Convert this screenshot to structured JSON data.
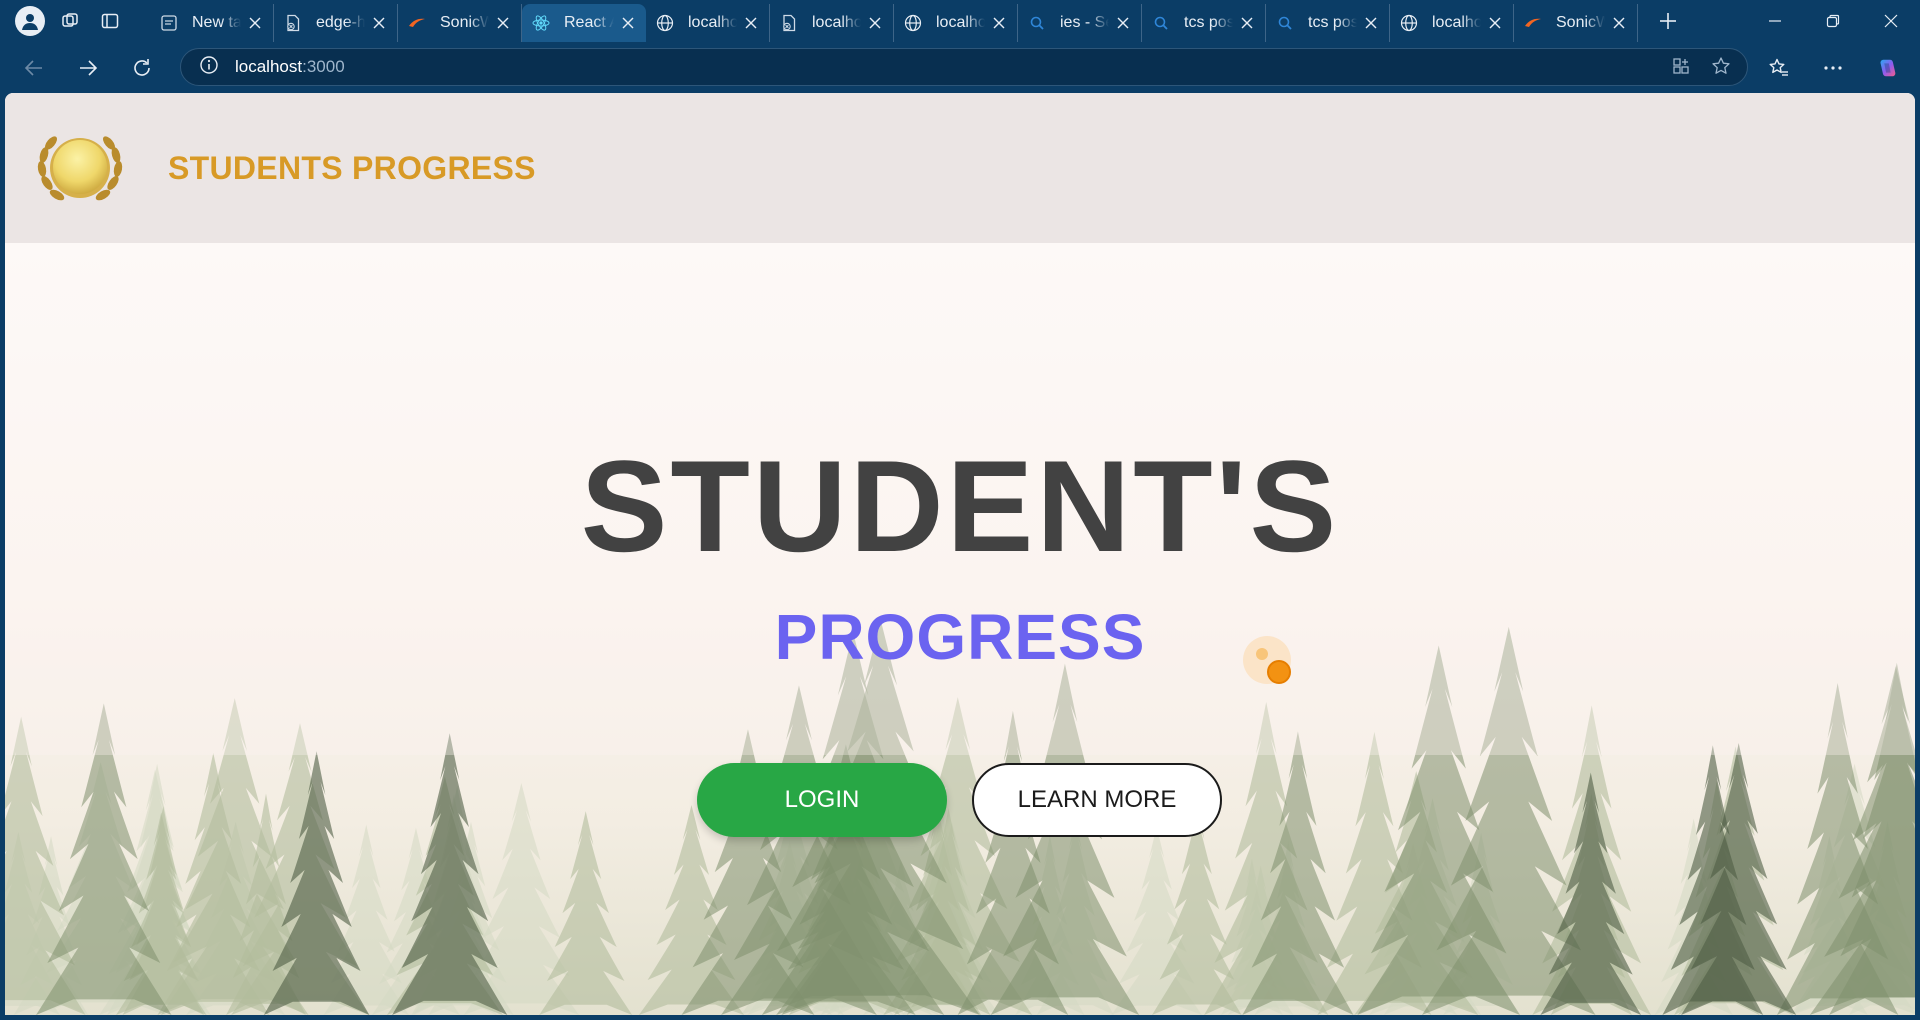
{
  "browser": {
    "tabs": [
      {
        "title": "New tab",
        "icon": "page-icon",
        "active": false
      },
      {
        "title": "edge-help",
        "icon": "pdf-file-icon",
        "active": false
      },
      {
        "title": "SonicWall",
        "icon": "sonicwall-logo-icon",
        "active": false
      },
      {
        "title": "React App",
        "icon": "react-logo-icon",
        "active": true
      },
      {
        "title": "localhost",
        "icon": "globe-icon",
        "active": false
      },
      {
        "title": "localhost",
        "icon": "pdf-file-icon",
        "active": false
      },
      {
        "title": "localhost",
        "icon": "globe-icon",
        "active": false
      },
      {
        "title": "ies - Search",
        "icon": "search-icon",
        "active": false
      },
      {
        "title": "tcs pos",
        "icon": "search-icon",
        "active": false
      },
      {
        "title": "tcs pos",
        "icon": "search-icon",
        "active": false
      },
      {
        "title": "localhost",
        "icon": "globe-icon",
        "active": false
      },
      {
        "title": "SonicWall",
        "icon": "sonicwall-logo-icon",
        "active": false
      }
    ],
    "address": {
      "host": "localhost",
      "port": ":3000"
    }
  },
  "site": {
    "brand": "STUDENTS PROGRESS",
    "hero_title": "STUDENT'S",
    "hero_subtitle": "PROGRESS",
    "login_label": "LOGIN",
    "learn_more_label": "LEARN MORE"
  },
  "colors": {
    "brand": "#d89a26",
    "title": "#424242",
    "subtitle": "#6b63f0",
    "login_bg": "#28a745",
    "browser_chrome": "#0b3d66"
  }
}
